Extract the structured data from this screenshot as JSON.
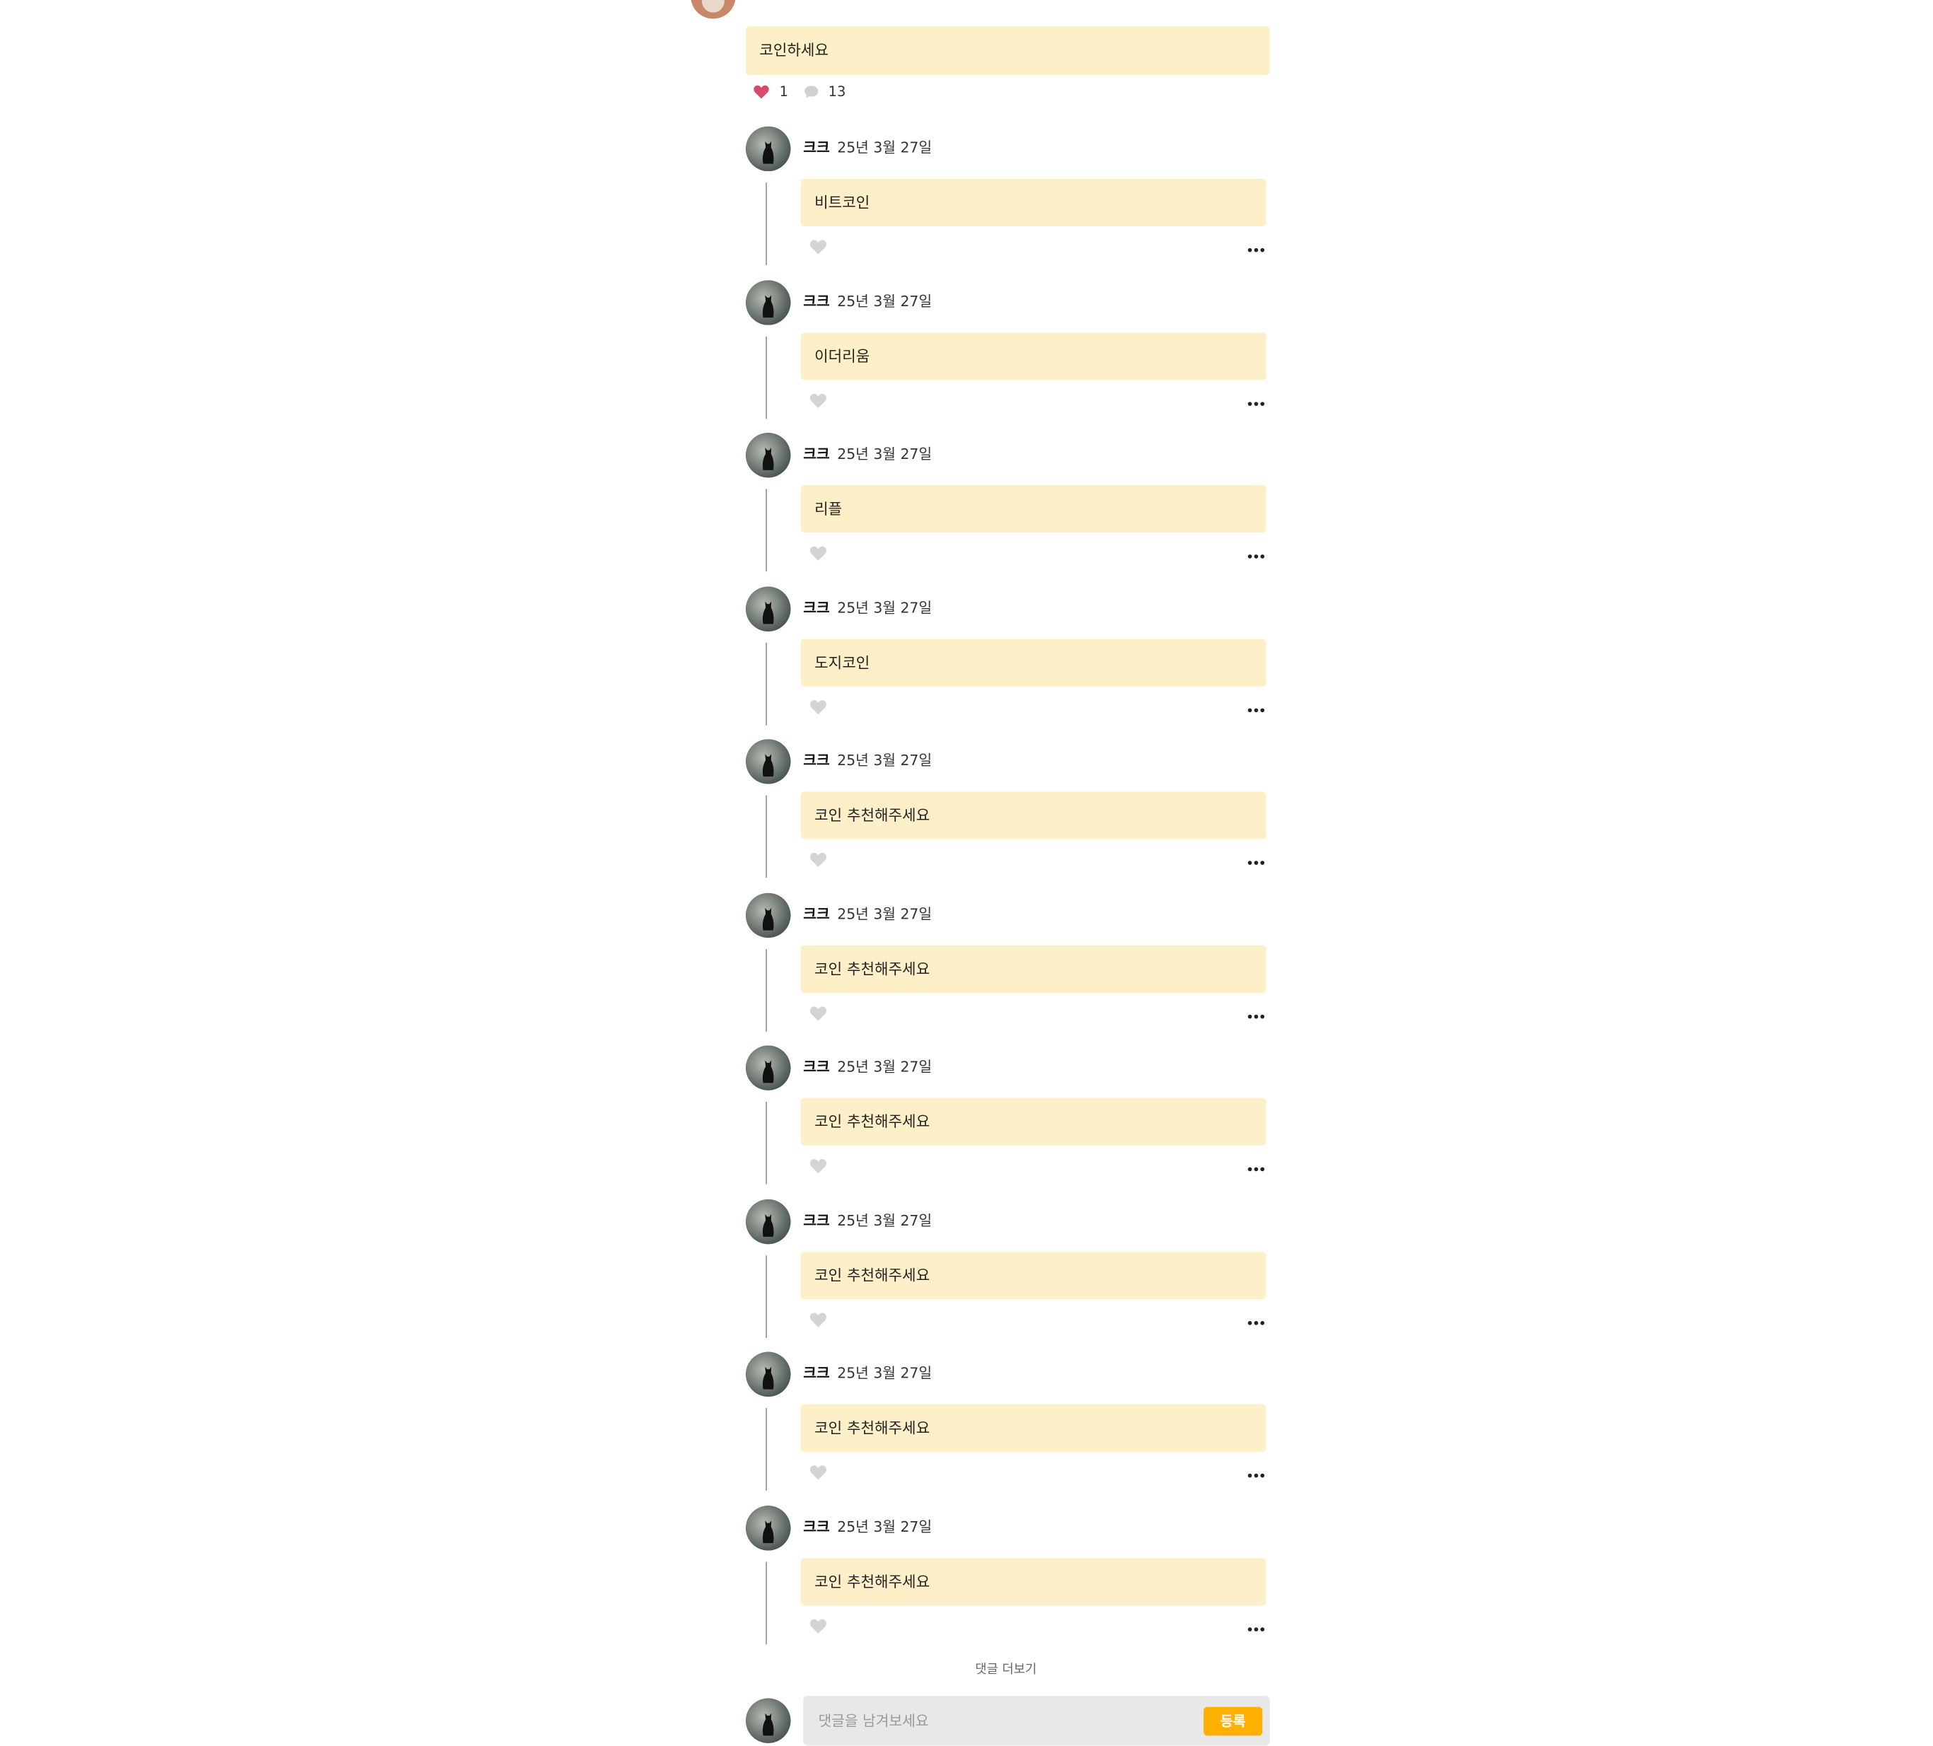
{
  "post": {
    "text": "코인하세요",
    "like_count": "1",
    "comment_count": "13",
    "liked": true
  },
  "replies": [
    {
      "author": "크크",
      "date": "25년 3월 27일",
      "text": "비트코인"
    },
    {
      "author": "크크",
      "date": "25년 3월 27일",
      "text": "이더리움"
    },
    {
      "author": "크크",
      "date": "25년 3월 27일",
      "text": "리플"
    },
    {
      "author": "크크",
      "date": "25년 3월 27일",
      "text": "도지코인"
    },
    {
      "author": "크크",
      "date": "25년 3월 27일",
      "text": "코인 추천해주세요"
    },
    {
      "author": "크크",
      "date": "25년 3월 27일",
      "text": "코인 추천해주세요"
    },
    {
      "author": "크크",
      "date": "25년 3월 27일",
      "text": "코인 추천해주세요"
    },
    {
      "author": "크크",
      "date": "25년 3월 27일",
      "text": "코인 추천해주세요"
    },
    {
      "author": "크크",
      "date": "25년 3월 27일",
      "text": "코인 추천해주세요"
    },
    {
      "author": "크크",
      "date": "25년 3월 27일",
      "text": "코인 추천해주세요"
    }
  ],
  "more_comments_label": "댓글 더보기",
  "composer": {
    "placeholder": "댓글을 남겨보세요",
    "submit_label": "등록"
  },
  "colors": {
    "bubble": "#fdf0c9",
    "accent": "#ffb000",
    "liked_heart": "#d94a6a",
    "unliked_heart": "#d4d4d4"
  },
  "icons": {
    "like": "heart-icon",
    "comment": "speech-bubble-icon",
    "more": "more-dots-icon"
  }
}
